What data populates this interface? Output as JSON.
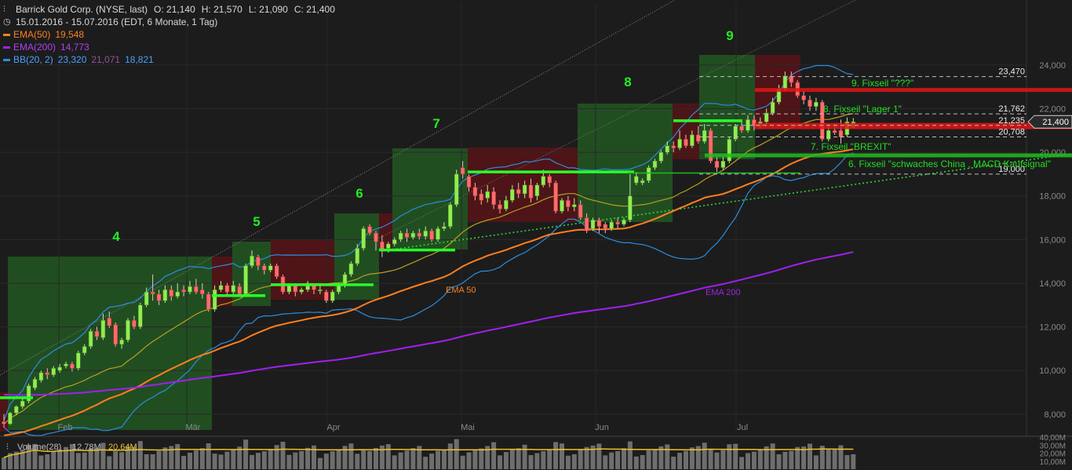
{
  "header": {
    "title": "Barrick Gold Corp. (NYSE, last)",
    "open": "O: 21,140",
    "high": "H: 21,570",
    "low": "L: 21,090",
    "close": "C: 21,400",
    "range": "15.01.2016 - 15.07.2016 (EDT, 6 Monate, 1 Tag)"
  },
  "legend": {
    "ema50": {
      "label": "EMA(50)",
      "value": "19,548",
      "color": "#ff7f1e"
    },
    "ema200": {
      "label": "EMA(200)",
      "value": "14,773",
      "color": "#a020f0"
    },
    "bb": {
      "label": "BB(20, 2)",
      "v1": "23,320",
      "v2": "21,071",
      "v3": "18,821",
      "color": "#2a8de0",
      "v2color": "#9a4fa0"
    },
    "volume": {
      "label": "Volume(28)",
      "v1": "12,78M",
      "v2": "20,64M"
    }
  },
  "colors": {
    "up": "#90ee50",
    "down": "#ff6b6b",
    "fib_green": "#2aff2a",
    "fib_red": "#e01515",
    "annot": "#22dd22"
  },
  "chart_data": {
    "type": "candlestick",
    "x_axis_labels": [
      "Feb",
      "Mär",
      "Apr",
      "Mai",
      "Jun",
      "Jul"
    ],
    "y_axis": {
      "ticks": [
        "8,000",
        "10,000",
        "12,000",
        "14,000",
        "16,000",
        "18,000",
        "20,000",
        "22,000",
        "24,000"
      ],
      "ylim": [
        7.2,
        25.4
      ]
    },
    "last_price": "21,400",
    "wave_labels": [
      "4",
      "5",
      "6",
      "7",
      "8",
      "9"
    ],
    "levels": [
      {
        "value": 23.47,
        "label": "23,470"
      },
      {
        "value": 21.762,
        "label": "21,762"
      },
      {
        "value": 21.235,
        "label": "21,235"
      },
      {
        "value": 20.708,
        "label": "20,708"
      },
      {
        "value": 19.0,
        "label": "19,000"
      }
    ],
    "annotations": [
      "9. Fixseil  \"???\"",
      "8. Fixseil  \"Lager 1\"",
      "7. Fixseil  \"BREXIT\"",
      "6. Fixseil  \"schwaches China , MACD Kaufsignal\""
    ],
    "line_labels": {
      "ema50": "EMA 50",
      "ema200": "EMA 200"
    },
    "ohlc": [
      [
        7.65,
        7.55,
        8.0,
        7.4
      ],
      [
        7.55,
        8.05,
        8.1,
        7.5
      ],
      [
        8.05,
        8.35,
        8.4,
        7.95
      ],
      [
        8.35,
        8.6,
        8.7,
        8.25
      ],
      [
        8.6,
        9.3,
        9.4,
        8.5
      ],
      [
        9.2,
        9.6,
        9.7,
        9.1
      ],
      [
        9.55,
        9.9,
        10.0,
        9.45
      ],
      [
        9.9,
        9.8,
        10.1,
        9.6
      ],
      [
        9.8,
        10.1,
        10.2,
        9.7
      ],
      [
        10.0,
        10.15,
        10.3,
        9.9
      ],
      [
        10.2,
        10.3,
        10.4,
        10.1
      ],
      [
        10.3,
        10.1,
        10.4,
        9.95
      ],
      [
        10.1,
        10.8,
        10.9,
        10.0
      ],
      [
        10.8,
        11.1,
        11.2,
        10.7
      ],
      [
        11.1,
        11.8,
        11.9,
        11.0
      ],
      [
        11.8,
        11.55,
        12.0,
        11.4
      ],
      [
        11.5,
        12.3,
        12.6,
        11.4
      ],
      [
        12.4,
        12.05,
        12.7,
        11.95
      ],
      [
        12.1,
        11.2,
        12.2,
        11.1
      ],
      [
        11.2,
        11.4,
        11.5,
        11.0
      ],
      [
        11.4,
        12.3,
        12.4,
        11.3
      ],
      [
        12.3,
        12.0,
        12.5,
        11.9
      ],
      [
        12.0,
        13.0,
        13.1,
        11.9
      ],
      [
        13.0,
        13.6,
        13.8,
        12.9
      ],
      [
        13.6,
        13.5,
        14.4,
        13.2
      ],
      [
        13.5,
        13.2,
        13.7,
        13.0
      ],
      [
        13.2,
        13.7,
        13.9,
        13.1
      ],
      [
        13.7,
        13.4,
        13.9,
        13.2
      ],
      [
        13.4,
        13.6,
        14.0,
        13.3
      ],
      [
        13.7,
        13.6,
        13.9,
        13.4
      ],
      [
        13.6,
        13.85,
        14.1,
        13.5
      ],
      [
        13.85,
        13.6,
        14.2,
        13.5
      ],
      [
        13.7,
        13.5,
        14.0,
        13.3
      ],
      [
        13.5,
        12.8,
        13.6,
        12.7
      ],
      [
        12.8,
        13.7,
        13.9,
        12.7
      ],
      [
        13.7,
        13.9,
        14.1,
        13.6
      ],
      [
        13.9,
        13.6,
        14.0,
        13.4
      ],
      [
        13.6,
        13.9,
        14.1,
        13.5
      ],
      [
        13.85,
        13.5,
        14.0,
        13.4
      ],
      [
        13.5,
        14.8,
        14.9,
        13.4
      ],
      [
        14.8,
        15.25,
        15.5,
        14.7
      ],
      [
        15.2,
        14.8,
        15.3,
        14.6
      ],
      [
        14.8,
        14.6,
        14.9,
        14.4
      ],
      [
        14.6,
        14.8,
        14.9,
        14.5
      ],
      [
        14.8,
        14.3,
        14.9,
        14.2
      ],
      [
        14.3,
        13.6,
        14.4,
        13.5
      ],
      [
        13.6,
        13.9,
        14.0,
        13.5
      ],
      [
        13.9,
        13.6,
        14.0,
        13.4
      ],
      [
        13.6,
        13.7,
        13.8,
        13.5
      ],
      [
        13.7,
        13.95,
        14.1,
        13.6
      ],
      [
        13.95,
        13.7,
        14.0,
        13.5
      ],
      [
        13.7,
        13.7,
        13.9,
        13.5
      ],
      [
        13.6,
        13.2,
        13.7,
        13.1
      ],
      [
        13.2,
        13.6,
        13.7,
        13.1
      ],
      [
        13.6,
        13.9,
        14.0,
        13.5
      ],
      [
        13.9,
        14.4,
        14.5,
        13.8
      ],
      [
        14.4,
        14.9,
        15.0,
        14.3
      ],
      [
        14.9,
        15.6,
        15.8,
        14.8
      ],
      [
        15.6,
        16.5,
        16.6,
        15.5
      ],
      [
        16.6,
        16.3,
        16.7,
        16.2
      ],
      [
        16.3,
        15.9,
        16.4,
        15.5
      ],
      [
        15.9,
        15.5,
        16.2,
        15.2
      ],
      [
        15.6,
        15.8,
        15.9,
        15.4
      ],
      [
        15.8,
        16.0,
        16.1,
        15.7
      ],
      [
        16.0,
        16.3,
        16.4,
        15.9
      ],
      [
        16.3,
        16.1,
        16.5,
        15.9
      ],
      [
        16.1,
        16.3,
        16.4,
        16.0
      ],
      [
        16.3,
        16.15,
        16.5,
        16.0
      ],
      [
        16.15,
        16.4,
        16.6,
        16.0
      ],
      [
        16.4,
        16.0,
        16.5,
        15.9
      ],
      [
        16.0,
        16.5,
        16.6,
        15.9
      ],
      [
        16.5,
        16.6,
        16.8,
        16.4
      ],
      [
        16.6,
        17.6,
        17.7,
        16.5
      ],
      [
        17.6,
        19.0,
        19.2,
        17.5
      ],
      [
        19.3,
        19.0,
        19.6,
        18.8
      ],
      [
        18.9,
        18.4,
        19.0,
        18.2
      ],
      [
        18.4,
        18.0,
        18.6,
        17.8
      ],
      [
        18.1,
        17.8,
        18.3,
        17.6
      ],
      [
        17.9,
        18.2,
        18.5,
        17.7
      ],
      [
        18.2,
        17.6,
        18.4,
        17.4
      ],
      [
        17.6,
        17.4,
        17.8,
        17.2
      ],
      [
        17.4,
        17.8,
        18.0,
        17.3
      ],
      [
        17.8,
        18.3,
        18.5,
        17.7
      ],
      [
        18.3,
        18.1,
        18.6,
        17.9
      ],
      [
        18.1,
        18.5,
        18.7,
        17.9
      ],
      [
        18.5,
        17.9,
        18.8,
        17.7
      ],
      [
        18.0,
        18.5,
        18.6,
        17.8
      ],
      [
        18.5,
        18.9,
        19.2,
        18.4
      ],
      [
        18.9,
        18.6,
        19.0,
        18.4
      ],
      [
        18.6,
        17.3,
        18.7,
        17.2
      ],
      [
        17.3,
        17.8,
        17.9,
        17.2
      ],
      [
        17.8,
        17.5,
        18.0,
        17.3
      ],
      [
        17.5,
        17.6,
        17.9,
        17.3
      ],
      [
        17.6,
        17.0,
        17.8,
        16.9
      ],
      [
        17.0,
        16.4,
        17.2,
        16.3
      ],
      [
        16.5,
        16.9,
        17.0,
        16.4
      ],
      [
        16.9,
        16.6,
        17.0,
        16.3
      ],
      [
        16.7,
        16.5,
        16.8,
        16.3
      ],
      [
        16.5,
        16.8,
        16.9,
        16.4
      ],
      [
        16.8,
        16.7,
        17.0,
        16.5
      ],
      [
        16.7,
        16.9,
        17.0,
        16.6
      ],
      [
        16.9,
        18.0,
        19.0,
        16.8
      ],
      [
        18.6,
        18.9,
        19.1,
        18.5
      ],
      [
        18.6,
        18.7,
        18.8,
        18.5
      ],
      [
        18.7,
        19.3,
        19.4,
        18.6
      ],
      [
        19.3,
        19.6,
        19.7,
        19.2
      ],
      [
        19.6,
        20.0,
        20.1,
        19.5
      ],
      [
        20.0,
        20.3,
        20.5,
        19.9
      ],
      [
        20.3,
        20.2,
        20.5,
        20.0
      ],
      [
        20.2,
        20.6,
        21.0,
        20.1
      ],
      [
        20.6,
        20.3,
        20.8,
        20.2
      ],
      [
        20.3,
        20.8,
        21.0,
        20.2
      ],
      [
        20.8,
        20.5,
        21.2,
        20.4
      ],
      [
        20.5,
        21.0,
        21.3,
        20.4
      ],
      [
        21.0,
        19.6,
        21.1,
        19.5
      ],
      [
        19.6,
        19.3,
        19.8,
        19.1
      ],
      [
        19.3,
        19.6,
        19.8,
        19.2
      ],
      [
        19.6,
        20.6,
        20.7,
        19.5
      ],
      [
        20.6,
        21.2,
        21.3,
        20.5
      ],
      [
        21.2,
        21.0,
        21.4,
        20.9
      ],
      [
        21.0,
        21.5,
        21.7,
        20.9
      ],
      [
        21.5,
        21.2,
        21.7,
        21.0
      ],
      [
        21.2,
        21.4,
        21.6,
        21.1
      ],
      [
        21.4,
        21.8,
        22.0,
        21.3
      ],
      [
        21.8,
        22.3,
        22.5,
        21.7
      ],
      [
        22.3,
        22.9,
        23.1,
        22.2
      ],
      [
        22.9,
        23.5,
        23.7,
        22.8
      ],
      [
        23.5,
        23.2,
        23.7,
        23.0
      ],
      [
        23.2,
        22.6,
        23.3,
        22.5
      ],
      [
        22.6,
        22.4,
        22.8,
        22.2
      ],
      [
        22.4,
        22.1,
        22.6,
        21.9
      ],
      [
        22.1,
        22.3,
        22.5,
        21.9
      ],
      [
        22.3,
        20.6,
        22.4,
        20.5
      ],
      [
        20.6,
        21.0,
        21.3,
        20.5
      ],
      [
        21.0,
        20.9,
        21.3,
        20.8
      ],
      [
        21.0,
        20.7,
        21.5,
        20.4
      ],
      [
        20.8,
        21.4,
        21.6,
        20.7
      ],
      [
        21.14,
        21.4,
        21.57,
        21.09
      ]
    ],
    "volume_ylim": [
      0,
      40
    ],
    "volume_ticks": [
      "10,00M",
      "20,00M",
      "30,00M",
      "40,00M"
    ]
  }
}
